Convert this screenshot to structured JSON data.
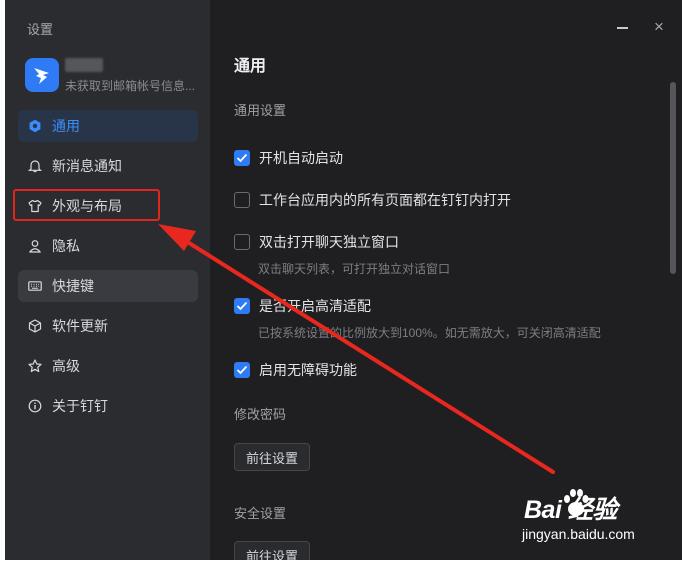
{
  "window": {
    "title": "设置",
    "controls": {
      "minimize": "minimize-icon",
      "close_symbol": "×"
    }
  },
  "profile": {
    "name": "",
    "subtitle": "未获取到邮箱帐号信息..."
  },
  "nav": {
    "items": [
      {
        "label": "通用",
        "icon": "settings-icon",
        "active": true
      },
      {
        "label": "新消息通知",
        "icon": "bell-icon"
      },
      {
        "label": "外观与布局",
        "icon": "shirt-icon"
      },
      {
        "label": "隐私",
        "icon": "user-icon"
      },
      {
        "label": "快捷键",
        "icon": "keyboard-icon"
      },
      {
        "label": "软件更新",
        "icon": "cube-icon"
      },
      {
        "label": "高级",
        "icon": "star-icon"
      },
      {
        "label": "关于钉钉",
        "icon": "info-icon"
      }
    ]
  },
  "main": {
    "title": "通用",
    "general_section": "通用设置",
    "options": [
      {
        "label": "开机自动启动",
        "checked": true,
        "description": ""
      },
      {
        "label": "工作台应用内的所有页面都在钉钉内打开",
        "checked": false,
        "description": ""
      },
      {
        "label": "双击打开聊天独立窗口",
        "checked": false,
        "description": "双击聊天列表，可打开独立对话窗口"
      },
      {
        "label": "是否开启高清适配",
        "checked": true,
        "description": "已按系统设置的比例放大到100%。如无需放大，可关闭高清适配"
      },
      {
        "label": "启用无障碍功能",
        "checked": true,
        "description": ""
      }
    ],
    "password_section": "修改密码",
    "password_button": "前往设置",
    "security_section": "安全设置",
    "security_button": "前往设置"
  },
  "colors": {
    "accent": "#2f7bf5",
    "annotation": "#e0261e",
    "sidebar_bg": "#2b2c30",
    "panel_bg": "#1f1f22"
  },
  "watermark": {
    "main": "Bai  经验",
    "sub": "jingyan.baidu.com"
  }
}
